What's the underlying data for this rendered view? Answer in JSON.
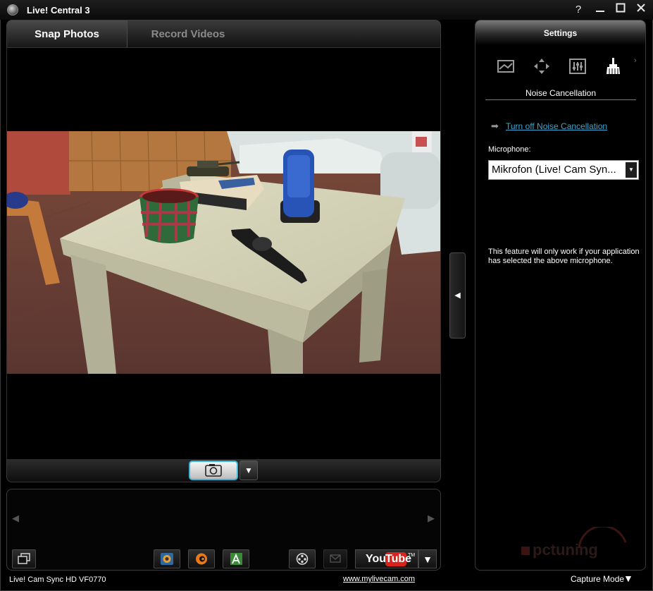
{
  "window": {
    "title": "Live! Central 3",
    "help": "?",
    "minimize": "—",
    "maximize": "☐",
    "close": "✕"
  },
  "tabs": [
    {
      "label": "Snap Photos",
      "active": true
    },
    {
      "label": "Record Videos",
      "active": false
    }
  ],
  "preview": {
    "capture_dropdown": "▼",
    "collapse_arrow": "◀"
  },
  "strip": {
    "left_arrow": "◀",
    "right_arrow": "▶"
  },
  "toolbar": {
    "youtube_you": "You",
    "youtube_tube": "Tube",
    "youtube_tm": "TM",
    "youtube_dropdown": "▼",
    "icons": [
      "gallery-icon",
      "camera-effects-icon",
      "audio-icon",
      "text-overlay-icon",
      "film-reel-icon",
      "email-icon"
    ]
  },
  "status": {
    "device": "Live! Cam Sync HD VF0770",
    "website": "www.mylivecam.com",
    "capture_mode": "Capture Mode",
    "capture_mode_arrow": "▼"
  },
  "settings": {
    "header": "Settings",
    "icons": [
      "image-adjust-icon",
      "pan-tilt-icon",
      "equalizer-icon",
      "broom-icon"
    ],
    "next_arrow": "›",
    "section_title": "Noise Cancellation",
    "toggle_link": "Turn off Noise Cancellation",
    "toggle_arrow": "➡",
    "microphone_label": "Microphone:",
    "microphone_value": "Mikrofon (Live! Cam Syn...",
    "microphone_dropdown": "▼",
    "note": "This feature will only work if your application has selected the above microphone."
  },
  "watermark": {
    "text": "pctuning"
  },
  "colors": {
    "accent": "#3cb6d8",
    "link": "#3aa7cf",
    "youtube_red": "#d8241c",
    "background": "#000000"
  }
}
